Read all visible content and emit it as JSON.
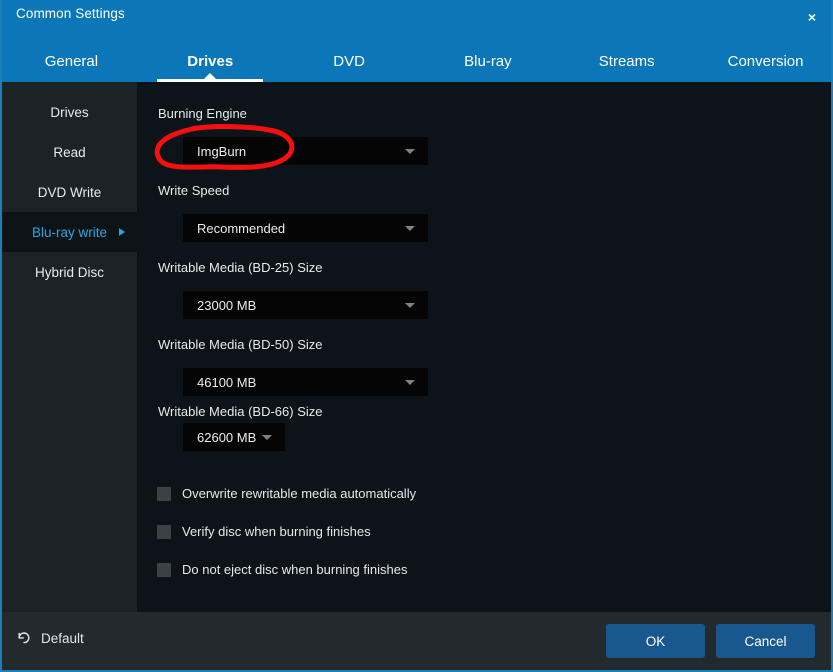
{
  "window": {
    "title": "Common Settings",
    "close_label": "×",
    "accent_blue": "#0b77b8",
    "panel_bg": "#0d1419",
    "sidebar_bg": "#1b2327",
    "button_blue": "#18588f",
    "annotation_color": "#f50f0f"
  },
  "tabs": [
    {
      "label": "General",
      "active": false
    },
    {
      "label": "Drives",
      "active": true
    },
    {
      "label": "DVD",
      "active": false
    },
    {
      "label": "Blu-ray",
      "active": false
    },
    {
      "label": "Streams",
      "active": false
    },
    {
      "label": "Conversion",
      "active": false
    }
  ],
  "sidebar": {
    "items": [
      {
        "label": "Drives",
        "selected": false
      },
      {
        "label": "Read",
        "selected": false
      },
      {
        "label": "DVD Write",
        "selected": false
      },
      {
        "label": "Blu-ray write",
        "selected": true
      },
      {
        "label": "Hybrid Disc",
        "selected": false
      }
    ]
  },
  "main": {
    "fields": [
      {
        "label": "Burning Engine",
        "value": "ImgBurn"
      },
      {
        "label": "Write Speed",
        "value": "Recommended"
      },
      {
        "label": "Writable Media (BD-25) Size",
        "value": "23000 MB"
      },
      {
        "label": "Writable Media (BD-50) Size",
        "value": "46100 MB"
      },
      {
        "label": "Writable Media (BD-66) Size",
        "value": "62600 MB"
      }
    ],
    "checkboxes": [
      {
        "label": "Overwrite rewritable media automatically",
        "checked": false
      },
      {
        "label": "Verify disc when burning finishes",
        "checked": false
      },
      {
        "label": "Do not eject disc when burning finishes",
        "checked": false
      }
    ]
  },
  "footer": {
    "default_label": "Default",
    "ok_label": "OK",
    "cancel_label": "Cancel"
  }
}
